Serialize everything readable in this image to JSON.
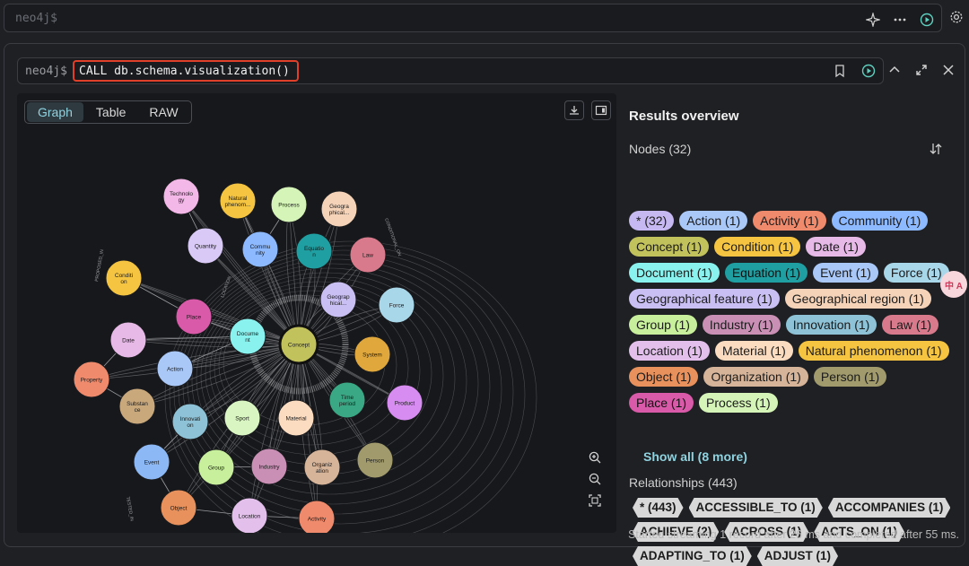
{
  "top": {
    "prompt": "neo4j$"
  },
  "query": {
    "prompt": "neo4j$",
    "text": "CALL db.schema.visualization()"
  },
  "tabs": [
    {
      "label": "Graph"
    },
    {
      "label": "Table"
    },
    {
      "label": "RAW"
    }
  ],
  "graph_nodes": [
    {
      "label": "Technolo gy",
      "color": "#f3b8e8"
    },
    {
      "label": "Natural phenom...",
      "color": "#f5c542"
    },
    {
      "label": "Process",
      "color": "#d5f5b8"
    },
    {
      "label": "Geogra phical...",
      "color": "#f5d3b8"
    },
    {
      "label": "Quantity",
      "color": "#d9c9f7"
    },
    {
      "label": "Commu nity",
      "color": "#8cb9ff"
    },
    {
      "label": "Equatio n",
      "color": "#1f9fa1"
    },
    {
      "label": "Law",
      "color": "#d97a8c"
    },
    {
      "label": "Conditi on",
      "color": "#f5c542"
    },
    {
      "label": "Geograp hical...",
      "color": "#c9bff2"
    },
    {
      "label": "Force",
      "color": "#a9d7ea"
    },
    {
      "label": "Place",
      "color": "#d95aa8"
    },
    {
      "label": "Docume nt",
      "color": "#8af2ee"
    },
    {
      "label": "Concept",
      "color": "#c2c25c"
    },
    {
      "label": "Date",
      "color": "#e6b9e6"
    },
    {
      "label": "System",
      "color": "#e0a83c"
    },
    {
      "label": "Action",
      "color": "#a9c8f7"
    },
    {
      "label": "Property",
      "color": "#f08a6c"
    },
    {
      "label": "Time period",
      "color": "#3aa884"
    },
    {
      "label": "Product",
      "color": "#d68cf0"
    },
    {
      "label": "Substan ce",
      "color": "#c9a87c"
    },
    {
      "label": "Innovati on",
      "color": "#8ec2d6"
    },
    {
      "label": "Sport",
      "color": "#d9f5c2"
    },
    {
      "label": "Material",
      "color": "#fbdcc0"
    },
    {
      "label": "Event",
      "color": "#8cb9f5"
    },
    {
      "label": "Group",
      "color": "#c7ef9c"
    },
    {
      "label": "Industry",
      "color": "#c98fb5"
    },
    {
      "label": "Organiz ation",
      "color": "#d6b49a"
    },
    {
      "label": "Person",
      "color": "#a09a6c"
    },
    {
      "label": "Object",
      "color": "#e8915c"
    },
    {
      "label": "Location",
      "color": "#e3c0ec"
    },
    {
      "label": "Activity",
      "color": "#f08a6c"
    }
  ],
  "edge_labels": [
    "PROPOSED_IN",
    "CARRIED_OUT",
    "LOCATED_IN",
    "INTERACTS_WITH",
    "CONDITIONAL_ON",
    "LOCATION",
    "TESTED_IN"
  ],
  "results": {
    "title": "Results overview",
    "nodes_label": "Nodes (32)",
    "nodes": [
      {
        "text": "* (32)",
        "color": "#c6b8f0"
      },
      {
        "text": "Action (1)",
        "color": "#a9c8f7"
      },
      {
        "text": "Activity (1)",
        "color": "#f08a6c"
      },
      {
        "text": "Community (1)",
        "color": "#8cb9ff"
      },
      {
        "text": "Concept (1)",
        "color": "#c2c25c"
      },
      {
        "text": "Condition (1)",
        "color": "#f5c542"
      },
      {
        "text": "Date (1)",
        "color": "#e6b9e6"
      },
      {
        "text": "Document (1)",
        "color": "#8af2ee"
      },
      {
        "text": "Equation (1)",
        "color": "#1f9fa1"
      },
      {
        "text": "Event (1)",
        "color": "#a9c8f7"
      },
      {
        "text": "Force (1)",
        "color": "#a9d7ea"
      },
      {
        "text": "Geographical feature (1)",
        "color": "#c9bff2"
      },
      {
        "text": "Geographical region (1)",
        "color": "#f5d3b8"
      },
      {
        "text": "Group (1)",
        "color": "#c7ef9c"
      },
      {
        "text": "Industry (1)",
        "color": "#c98fb5"
      },
      {
        "text": "Innovation (1)",
        "color": "#8ec2d6"
      },
      {
        "text": "Law (1)",
        "color": "#d97a8c"
      },
      {
        "text": "Location (1)",
        "color": "#e3c0ec"
      },
      {
        "text": "Material (1)",
        "color": "#fbdcc0"
      },
      {
        "text": "Natural phenomenon (1)",
        "color": "#f5c542"
      },
      {
        "text": "Object (1)",
        "color": "#e8915c"
      },
      {
        "text": "Organization (1)",
        "color": "#d6b49a"
      },
      {
        "text": "Person (1)",
        "color": "#a09a6c"
      },
      {
        "text": "Place (1)",
        "color": "#d95aa8"
      },
      {
        "text": "Process (1)",
        "color": "#d5f5b8"
      }
    ],
    "show_all": "Show all (8 more)",
    "relationships_label": "Relationships (443)",
    "relationships": [
      "* (443)",
      "ACCESSIBLE_TO (1)",
      "ACCOMPANIES (1)",
      "ACHIEVE (2)",
      "ACROSS (1)",
      "ACTS_ON (1)",
      "ADAPTING_TO (1)",
      "ADJUST (1)"
    ],
    "footer": "Started streaming 1 record after 26 ms and completed after 55 ms."
  },
  "side_badge": "中 A"
}
